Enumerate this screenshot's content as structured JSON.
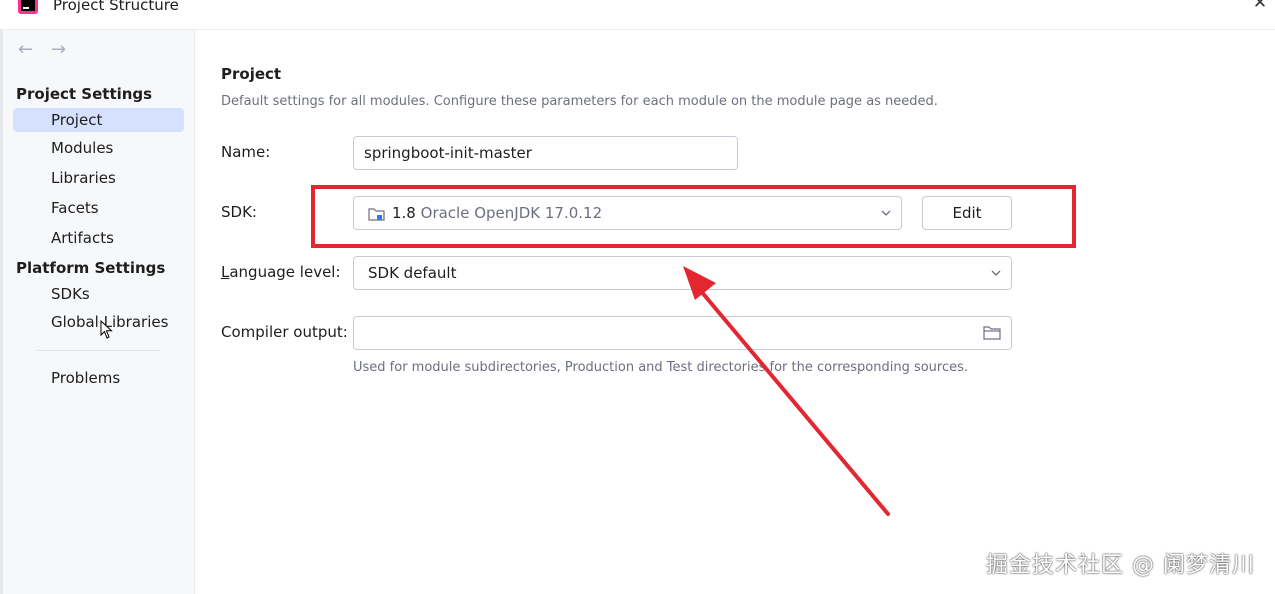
{
  "window": {
    "title": "Project Structure"
  },
  "sidebar": {
    "project_settings_title": "Project Settings",
    "project_items": [
      "Project",
      "Modules",
      "Libraries",
      "Facets",
      "Artifacts"
    ],
    "platform_settings_title": "Platform Settings",
    "platform_items": [
      "SDKs",
      "Global Libraries"
    ],
    "problems": "Problems",
    "selected": "Project"
  },
  "main": {
    "heading": "Project",
    "description": "Default settings for all modules. Configure these parameters for each module on the module page as needed.",
    "name_label": "Name:",
    "name_value": "springboot-init-master",
    "sdk_label": "SDK:",
    "sdk_version": "1.8",
    "sdk_name": "Oracle OpenJDK 17.0.12",
    "edit_label": "Edit",
    "language_label_l": "L",
    "language_label_rest": "anguage level:",
    "language_value": "SDK default",
    "compiler_label": "Compiler output:",
    "compiler_value": "",
    "compiler_hint": "Used for module subdirectories, Production and Test directories for the corresponding sources."
  },
  "annotation": {
    "color": "#e3262f"
  },
  "watermark": "掘金技术社区 @ 阑梦清川"
}
